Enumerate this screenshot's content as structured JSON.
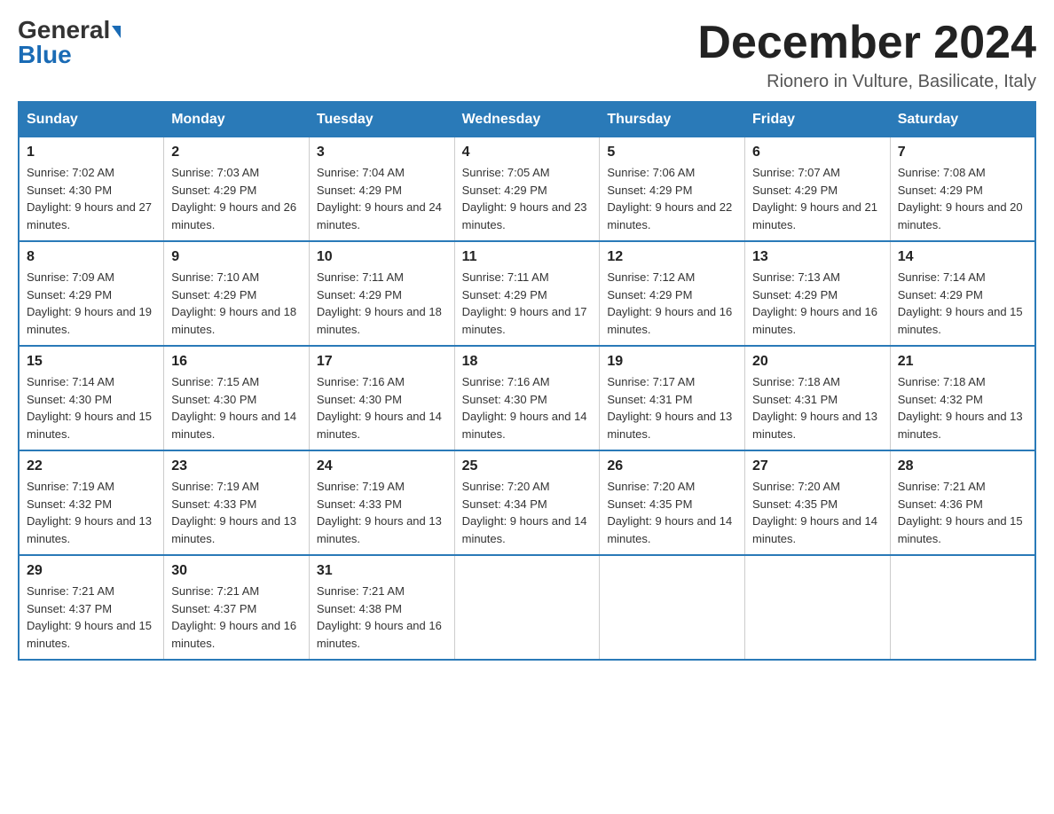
{
  "header": {
    "logo_line1": "General",
    "logo_line2": "Blue",
    "month_title": "December 2024",
    "subtitle": "Rionero in Vulture, Basilicate, Italy"
  },
  "days_of_week": [
    "Sunday",
    "Monday",
    "Tuesday",
    "Wednesday",
    "Thursday",
    "Friday",
    "Saturday"
  ],
  "weeks": [
    [
      {
        "day": "1",
        "sunrise": "7:02 AM",
        "sunset": "4:30 PM",
        "daylight": "9 hours and 27 minutes."
      },
      {
        "day": "2",
        "sunrise": "7:03 AM",
        "sunset": "4:29 PM",
        "daylight": "9 hours and 26 minutes."
      },
      {
        "day": "3",
        "sunrise": "7:04 AM",
        "sunset": "4:29 PM",
        "daylight": "9 hours and 24 minutes."
      },
      {
        "day": "4",
        "sunrise": "7:05 AM",
        "sunset": "4:29 PM",
        "daylight": "9 hours and 23 minutes."
      },
      {
        "day": "5",
        "sunrise": "7:06 AM",
        "sunset": "4:29 PM",
        "daylight": "9 hours and 22 minutes."
      },
      {
        "day": "6",
        "sunrise": "7:07 AM",
        "sunset": "4:29 PM",
        "daylight": "9 hours and 21 minutes."
      },
      {
        "day": "7",
        "sunrise": "7:08 AM",
        "sunset": "4:29 PM",
        "daylight": "9 hours and 20 minutes."
      }
    ],
    [
      {
        "day": "8",
        "sunrise": "7:09 AM",
        "sunset": "4:29 PM",
        "daylight": "9 hours and 19 minutes."
      },
      {
        "day": "9",
        "sunrise": "7:10 AM",
        "sunset": "4:29 PM",
        "daylight": "9 hours and 18 minutes."
      },
      {
        "day": "10",
        "sunrise": "7:11 AM",
        "sunset": "4:29 PM",
        "daylight": "9 hours and 18 minutes."
      },
      {
        "day": "11",
        "sunrise": "7:11 AM",
        "sunset": "4:29 PM",
        "daylight": "9 hours and 17 minutes."
      },
      {
        "day": "12",
        "sunrise": "7:12 AM",
        "sunset": "4:29 PM",
        "daylight": "9 hours and 16 minutes."
      },
      {
        "day": "13",
        "sunrise": "7:13 AM",
        "sunset": "4:29 PM",
        "daylight": "9 hours and 16 minutes."
      },
      {
        "day": "14",
        "sunrise": "7:14 AM",
        "sunset": "4:29 PM",
        "daylight": "9 hours and 15 minutes."
      }
    ],
    [
      {
        "day": "15",
        "sunrise": "7:14 AM",
        "sunset": "4:30 PM",
        "daylight": "9 hours and 15 minutes."
      },
      {
        "day": "16",
        "sunrise": "7:15 AM",
        "sunset": "4:30 PM",
        "daylight": "9 hours and 14 minutes."
      },
      {
        "day": "17",
        "sunrise": "7:16 AM",
        "sunset": "4:30 PM",
        "daylight": "9 hours and 14 minutes."
      },
      {
        "day": "18",
        "sunrise": "7:16 AM",
        "sunset": "4:30 PM",
        "daylight": "9 hours and 14 minutes."
      },
      {
        "day": "19",
        "sunrise": "7:17 AM",
        "sunset": "4:31 PM",
        "daylight": "9 hours and 13 minutes."
      },
      {
        "day": "20",
        "sunrise": "7:18 AM",
        "sunset": "4:31 PM",
        "daylight": "9 hours and 13 minutes."
      },
      {
        "day": "21",
        "sunrise": "7:18 AM",
        "sunset": "4:32 PM",
        "daylight": "9 hours and 13 minutes."
      }
    ],
    [
      {
        "day": "22",
        "sunrise": "7:19 AM",
        "sunset": "4:32 PM",
        "daylight": "9 hours and 13 minutes."
      },
      {
        "day": "23",
        "sunrise": "7:19 AM",
        "sunset": "4:33 PM",
        "daylight": "9 hours and 13 minutes."
      },
      {
        "day": "24",
        "sunrise": "7:19 AM",
        "sunset": "4:33 PM",
        "daylight": "9 hours and 13 minutes."
      },
      {
        "day": "25",
        "sunrise": "7:20 AM",
        "sunset": "4:34 PM",
        "daylight": "9 hours and 14 minutes."
      },
      {
        "day": "26",
        "sunrise": "7:20 AM",
        "sunset": "4:35 PM",
        "daylight": "9 hours and 14 minutes."
      },
      {
        "day": "27",
        "sunrise": "7:20 AM",
        "sunset": "4:35 PM",
        "daylight": "9 hours and 14 minutes."
      },
      {
        "day": "28",
        "sunrise": "7:21 AM",
        "sunset": "4:36 PM",
        "daylight": "9 hours and 15 minutes."
      }
    ],
    [
      {
        "day": "29",
        "sunrise": "7:21 AM",
        "sunset": "4:37 PM",
        "daylight": "9 hours and 15 minutes."
      },
      {
        "day": "30",
        "sunrise": "7:21 AM",
        "sunset": "4:37 PM",
        "daylight": "9 hours and 16 minutes."
      },
      {
        "day": "31",
        "sunrise": "7:21 AM",
        "sunset": "4:38 PM",
        "daylight": "9 hours and 16 minutes."
      },
      null,
      null,
      null,
      null
    ]
  ]
}
